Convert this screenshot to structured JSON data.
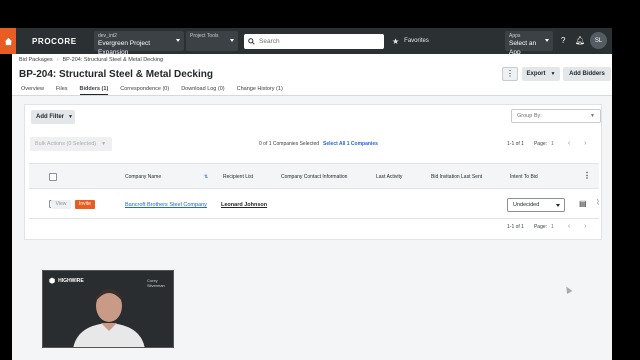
{
  "topbar": {
    "logo": "PROCORE",
    "project_sub": "dev_int2",
    "project_main": "Evergreen Project Expansion",
    "tools_label": "Project Tools",
    "search_placeholder": "Search",
    "favorites": "Favorites",
    "apps_sub": "Apps",
    "apps_main": "Select an App",
    "avatar_initials": "SL",
    "accent_color": "#e85d22"
  },
  "breadcrumb": {
    "root": "Bid Packages",
    "current": "BP-204: Structural Steel & Metal Decking"
  },
  "page_title": "BP-204: Structural Steel & Metal Decking",
  "tabs": [
    {
      "label": "Overview"
    },
    {
      "label": "Files"
    },
    {
      "label": "Bidders (1)",
      "active": true
    },
    {
      "label": "Correspondence (0)"
    },
    {
      "label": "Download Log (0)"
    },
    {
      "label": "Change History (1)"
    }
  ],
  "header_actions": {
    "export": "Export",
    "add_bidders": "Add Bidders"
  },
  "toolbar": {
    "add_filter": "Add Filter",
    "group_by": "Group By:",
    "bulk_actions": "Bulk Actions (0 Selected)",
    "selection_info": "0 of 1 Companies Selected",
    "select_all": "Select All 1 Companies",
    "range": "1-1 of 1",
    "page_label": "Page:",
    "page_value": "1"
  },
  "table": {
    "columns": [
      "Company Name",
      "Recipient List",
      "Company Contact Information",
      "Last Activity",
      "Bid Invitation Last Sent",
      "Intent To Bid"
    ],
    "rows": [
      {
        "view": "View",
        "invite": "Invite",
        "company": "Bancroft Brothers Steel Company",
        "recipient": "Leonard Johnson",
        "contact": "",
        "last_activity": "",
        "last_sent": "",
        "intent": "Undecided"
      }
    ]
  },
  "video": {
    "brand": "HIGHWIRE",
    "participant": "Corey Silverman"
  }
}
